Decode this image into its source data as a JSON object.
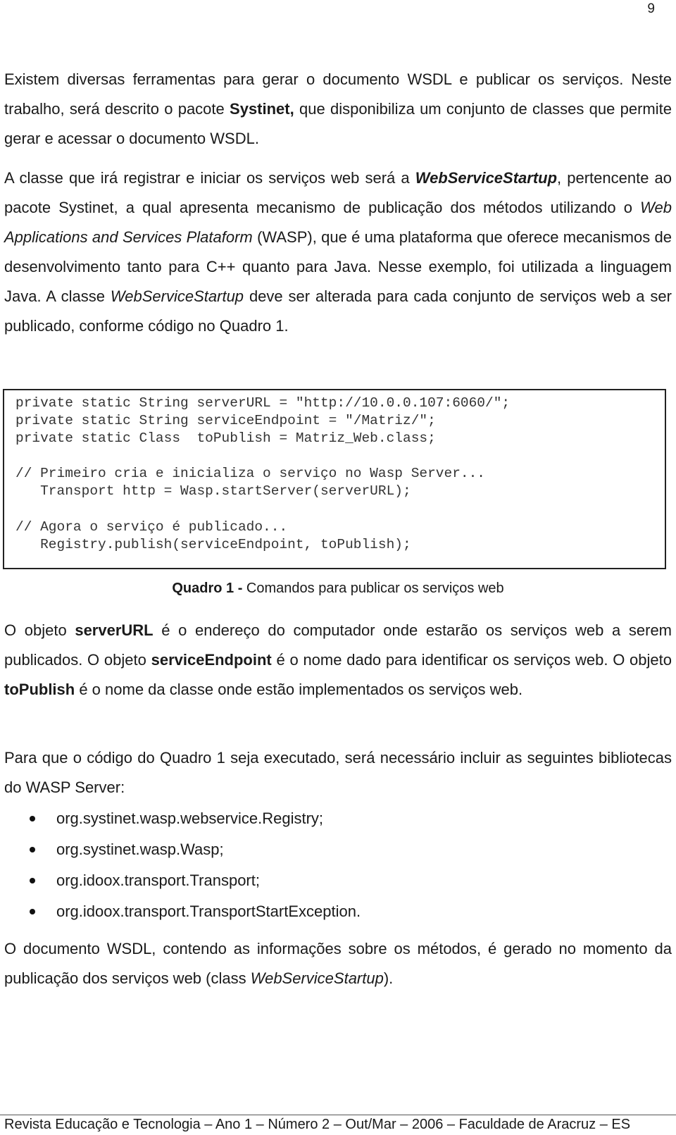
{
  "page_number": "9",
  "paragraph1": {
    "t1": "Existem diversas ferramentas para gerar o documento WSDL e publicar os serviços. Neste trabalho, será descrito o pacote ",
    "b1": "Systinet,",
    "t2": " que disponibiliza um conjunto de classes que permite gerar e acessar o documento WSDL."
  },
  "paragraph2": {
    "t1": "A classe que irá registrar e iniciar os serviços web será a ",
    "bi1": "WebServiceStartup",
    "t2": ", pertencente ao pacote Systinet, a qual apresenta mecanismo de publicação dos métodos utilizando o ",
    "i1": "Web Applications and Services Plataform",
    "t3": " (WASP), que é uma plataforma que oferece mecanismos de desenvolvimento tanto para C++ quanto para Java. Nesse exemplo, foi utilizada a linguagem Java. A classe ",
    "i2": "WebServiceStartup",
    "t4": " deve ser alterada para cada conjunto de serviços web a ser publicado, conforme código no Quadro 1."
  },
  "code": [
    "private static String serverURL = \"http://10.0.0.107:6060/\";",
    "private static String serviceEndpoint = \"/Matriz/\";",
    "private static Class  toPublish = Matriz_Web.class;",
    "// Primeiro cria e inicializa o serviço no Wasp Server...",
    "   Transport http = Wasp.startServer(serverURL);",
    "// Agora o serviço é publicado...",
    "   Registry.publish(serviceEndpoint, toPublish);"
  ],
  "caption": {
    "bold": "Quadro 1 -",
    "text": " Comandos para publicar os serviços web"
  },
  "paragraph3": {
    "t1": "O objeto ",
    "b1": "serverURL",
    "t2": " é o endereço do computador onde estarão os serviços web a serem publicados. O objeto ",
    "b2": "serviceEndpoint",
    "t3": " é o nome dado para identificar os serviços web. O objeto ",
    "b3": "toPublish",
    "t4": " é o nome da classe onde estão implementados os serviços web."
  },
  "paragraph4": "Para que o código do Quadro 1 seja executado, será necessário incluir as seguintes bibliotecas do WASP Server:",
  "libraries": [
    "org.systinet.wasp.webservice.Registry;",
    "org.systinet.wasp.Wasp;",
    "org.idoox.transport.Transport;",
    "org.idoox.transport.TransportStartException."
  ],
  "paragraph5": {
    "t1": "O documento WSDL, contendo as informações sobre os métodos, é gerado no momento da publicação dos serviços web (class ",
    "i1": "WebServiceStartup",
    "t2": ")."
  },
  "footer": "Revista Educação e Tecnologia – Ano 1 – Número 2 – Out/Mar – 2006 – Faculdade de Aracruz – ES"
}
